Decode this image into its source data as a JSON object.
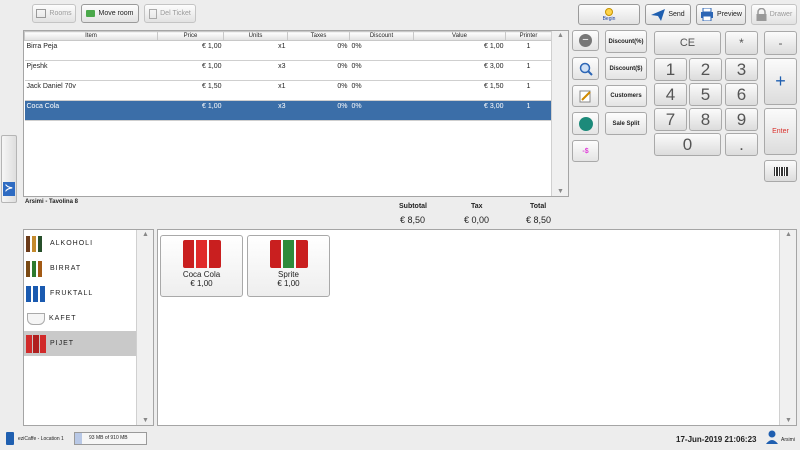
{
  "toolbar": {
    "rooms": "Rooms",
    "move_room": "Move room",
    "del_ticket": "Del Ticket",
    "begin": "Begin",
    "send": "Send",
    "preview": "Preview",
    "drawer": "Drawer"
  },
  "ticket": {
    "columns": [
      "Item",
      "Price",
      "Units",
      "Taxes",
      "Discount",
      "Value",
      "Printer"
    ],
    "rows": [
      {
        "item": "Birra Peja",
        "price": "€ 1,00",
        "units": "x1",
        "taxes": "0%",
        "discount": "0%",
        "value": "€ 1,00",
        "printer": "1"
      },
      {
        "item": "Pjeshk",
        "price": "€ 1,00",
        "units": "x3",
        "taxes": "0%",
        "discount": "0%",
        "value": "€ 3,00",
        "printer": "1"
      },
      {
        "item": "Jack Daniel 70v",
        "price": "€ 1,50",
        "units": "x1",
        "taxes": "0%",
        "discount": "0%",
        "value": "€ 1,50",
        "printer": "1"
      },
      {
        "item": "Coca Cola",
        "price": "€ 1,00",
        "units": "x3",
        "taxes": "0%",
        "discount": "0%",
        "value": "€ 3,00",
        "printer": "1"
      }
    ],
    "table_name": "Arsimi - Tavolina 8"
  },
  "totals": {
    "subtotal_label": "Subtotal",
    "tax_label": "Tax",
    "total_label": "Total",
    "subtotal": "€ 8,50",
    "tax": "€ 0,00",
    "total": "€ 8,50"
  },
  "discounts": {
    "percent": "Discount(%)",
    "amount": "Discount($)",
    "customers": "Customers",
    "sale_split": "Sale Split",
    "minus_label": "-$"
  },
  "keypad": {
    "ce": "CE",
    "star": "*",
    "minus": "-",
    "plus": "+",
    "enter": "Enter",
    "digits": [
      "1",
      "2",
      "3",
      "4",
      "5",
      "6",
      "7",
      "8",
      "9"
    ],
    "zero": "0",
    "dot": "."
  },
  "categories": [
    {
      "label": "ALKOHOLI",
      "selected": false
    },
    {
      "label": "BIRRAT",
      "selected": false
    },
    {
      "label": "FRUKTALL",
      "selected": false
    },
    {
      "label": "KAFET",
      "selected": false
    },
    {
      "label": "PIJET",
      "selected": true
    }
  ],
  "products": [
    {
      "name": "Coca Cola",
      "price": "€ 1,00"
    },
    {
      "name": "Sprite",
      "price": "€ 1,00"
    }
  ],
  "status": {
    "location": "eziCaffe - Location 1",
    "memory": "93 MB of 910 MB",
    "memory_fraction": 0.102,
    "datetime": "17-Jun-2019 21:06:23",
    "user": "Arsimi"
  },
  "colors": {
    "selection": "#3b6ea8",
    "enter_text": "#d9302b",
    "plus_text": "#1f5fb0"
  }
}
